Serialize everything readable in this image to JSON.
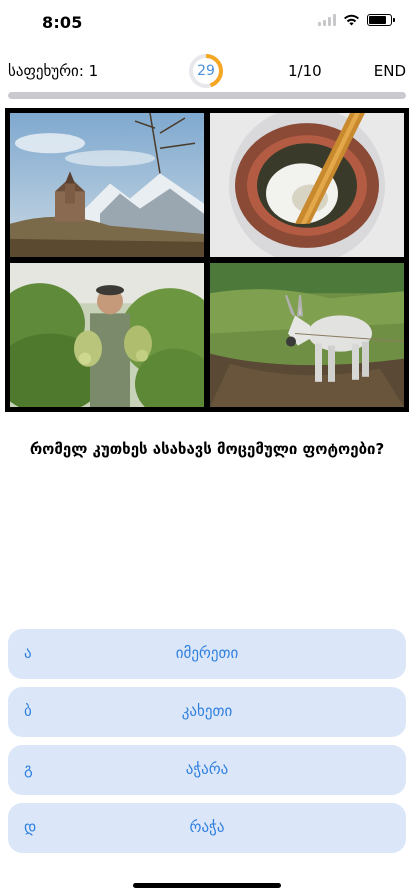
{
  "status_bar": {
    "time": "8:05",
    "battery_level_percent": 85
  },
  "game": {
    "level_label": "საფეხური: 1",
    "timer_seconds": "29",
    "timer_fraction_remaining": 0.45,
    "question_counter": "1/10",
    "end_label": "END",
    "progress_fraction": 1.0
  },
  "photos": [
    {
      "icon": "castle-landscape-photo"
    },
    {
      "icon": "wine-vessel-photo"
    },
    {
      "icon": "farmer-vineyard-photo"
    },
    {
      "icon": "donkey-photo"
    }
  ],
  "question": "რომელ კუთხეს ასახავს მოცემული ფოტოები?",
  "answers": [
    {
      "letter": "ა",
      "text": "იმერეთი"
    },
    {
      "letter": "ბ",
      "text": "კახეთი"
    },
    {
      "letter": "გ",
      "text": "აჭარა"
    },
    {
      "letter": "დ",
      "text": "რაჭა"
    }
  ],
  "colors": {
    "accent": "#2f7fe0",
    "answer_bg": "#dbe7f9",
    "timer_ring": "#f5a623",
    "timer_text": "#4a90d9"
  }
}
